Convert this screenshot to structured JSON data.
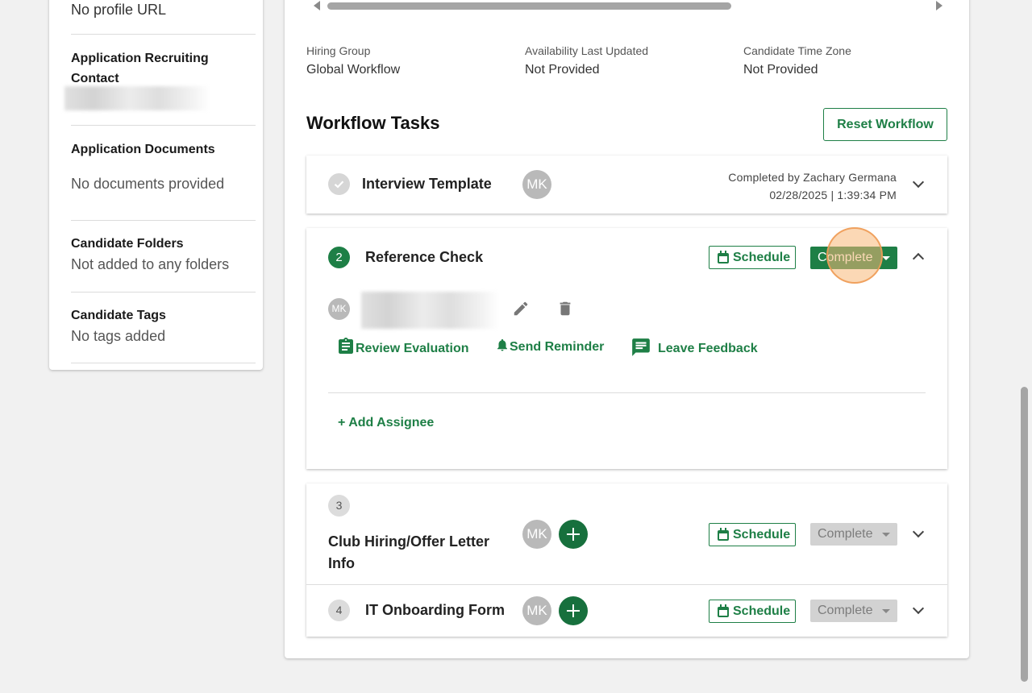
{
  "left": {
    "profile_url_value": "No profile URL",
    "recruiting_contact_label": "Application Recruiting Contact",
    "documents_label": "Application Documents",
    "documents_value": "No documents provided",
    "folders_label": "Candidate Folders",
    "folders_value": "Not added to any folders",
    "tags_label": "Candidate Tags",
    "tags_value": "No tags added"
  },
  "info": {
    "hiring_group_label": "Hiring Group",
    "hiring_group_value": "Global Workflow",
    "availability_label": "Availability Last Updated",
    "availability_value": "Not Provided",
    "timezone_label": "Candidate Time Zone",
    "timezone_value": "Not Provided"
  },
  "workflow": {
    "title": "Workflow Tasks",
    "reset_label": "Reset Workflow",
    "tasks": [
      {
        "number": "",
        "name": "Interview Template",
        "avatar": "MK",
        "completed_by": "Completed by Zachary Germana",
        "completed_at": "02/28/2025 | 1:39:34 PM"
      },
      {
        "number": "2",
        "name": "Reference Check",
        "schedule_label": "Schedule",
        "complete_label": "Complete",
        "assignee_avatar": "MK",
        "actions": {
          "review": "Review Evaluation",
          "remind": "Send Reminder",
          "feedback": "Leave Feedback"
        },
        "add_assignee": "+ Add Assignee"
      },
      {
        "number": "3",
        "name": "Club Hiring/Offer Letter Info",
        "avatar": "MK",
        "schedule_label": "Schedule",
        "complete_label": "Complete"
      },
      {
        "number": "4",
        "name": "IT Onboarding Form",
        "avatar": "MK",
        "schedule_label": "Schedule",
        "complete_label": "Complete"
      }
    ]
  },
  "colors": {
    "brand_green": "#1e7f46",
    "disabled_grey": "#d2d2d2",
    "background": "#f1f1f1"
  }
}
